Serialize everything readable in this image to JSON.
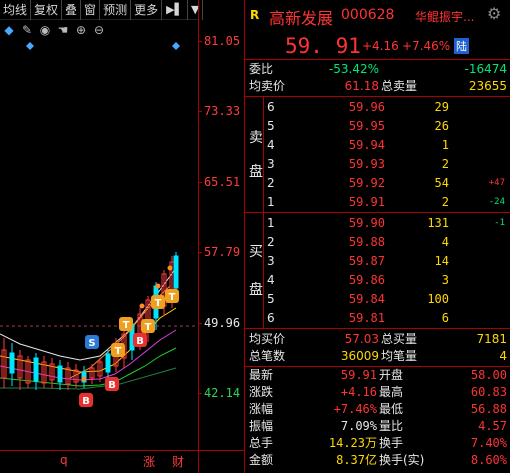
{
  "toolbar": {
    "items": [
      "均线",
      "复权",
      "叠",
      "窗",
      "预测",
      "更多"
    ],
    "pin_icon": "pin-icon",
    "menu_icon": "down-arrow"
  },
  "chart_tools": {
    "icons": [
      "diamond-icon",
      "pencil-icon",
      "eye-icon",
      "hand-icon",
      "zoom-in-icon",
      "zoom-out-icon"
    ]
  },
  "price_axis": {
    "ticks": [
      "81.05",
      "73.33",
      "65.51",
      "57.79",
      "49.96",
      "42.14"
    ],
    "reference_line": "49.96"
  },
  "chart_badges": [
    "B",
    "B",
    "B",
    "S",
    "T",
    "T",
    "T",
    "T",
    "T"
  ],
  "bottom_bar": {
    "left": "q",
    "zhang": "涨",
    "cai": "财"
  },
  "header": {
    "marker": "R",
    "name": "高新发展",
    "code": "000628",
    "link": "华鲲振宇...",
    "settings_icon": "gear-icon"
  },
  "quote": {
    "price": "59. 91",
    "change": "+4.16",
    "change_pct": "+7.46%",
    "badge": "陆"
  },
  "commission": {
    "label1": "委比",
    "value1": "-53.42%",
    "value2": "-16474",
    "label2": "均卖价",
    "value3": "61.18",
    "label3": "总卖量",
    "value4": "23655"
  },
  "sell_label": [
    "卖",
    "盘"
  ],
  "buy_label": [
    "买",
    "盘"
  ],
  "asks": [
    {
      "level": "6",
      "price": "59.96",
      "vol": "29",
      "chg": ""
    },
    {
      "level": "5",
      "price": "59.95",
      "vol": "26",
      "chg": ""
    },
    {
      "level": "4",
      "price": "59.94",
      "vol": "1",
      "chg": ""
    },
    {
      "level": "3",
      "price": "59.93",
      "vol": "2",
      "chg": ""
    },
    {
      "level": "2",
      "price": "59.92",
      "vol": "54",
      "chg": "+47"
    },
    {
      "level": "1",
      "price": "59.91",
      "vol": "2",
      "chg": "-24"
    }
  ],
  "bids": [
    {
      "level": "1",
      "price": "59.90",
      "vol": "131",
      "chg": "-1"
    },
    {
      "level": "2",
      "price": "59.88",
      "vol": "4",
      "chg": ""
    },
    {
      "level": "3",
      "price": "59.87",
      "vol": "14",
      "chg": ""
    },
    {
      "level": "4",
      "price": "59.86",
      "vol": "3",
      "chg": ""
    },
    {
      "level": "5",
      "price": "59.84",
      "vol": "100",
      "chg": ""
    },
    {
      "level": "6",
      "price": "59.81",
      "vol": "6",
      "chg": ""
    }
  ],
  "buy_summary": {
    "label1": "均买价",
    "value1": "57.03",
    "label2": "总买量",
    "value2": "7181",
    "label3": "总笔数",
    "value3": "36009",
    "label4": "均笔量",
    "value4": "4"
  },
  "stats": [
    {
      "l1": "最新",
      "v1": "59.91",
      "l2": "开盘",
      "v2": "58.00"
    },
    {
      "l1": "涨跌",
      "v1": "+4.16",
      "l2": "最高",
      "v2": "60.83"
    },
    {
      "l1": "涨幅",
      "v1": "+7.46%",
      "l2": "最低",
      "v2": "56.88"
    },
    {
      "l1": "振幅",
      "v1": "7.09%",
      "l2": "量比",
      "v2": "4.57"
    },
    {
      "l1": "总手",
      "v1": "14.23万",
      "l2": "换手",
      "v2": "7.40%"
    },
    {
      "l1": "金额",
      "v1": "8.37亿",
      "l2": "换手(实)",
      "v2": "8.60%"
    }
  ],
  "colors": {
    "up": "#ff3333",
    "down": "#00e676",
    "volume": "#ffd800",
    "border": "#aa0000",
    "name": "#ff3333"
  }
}
